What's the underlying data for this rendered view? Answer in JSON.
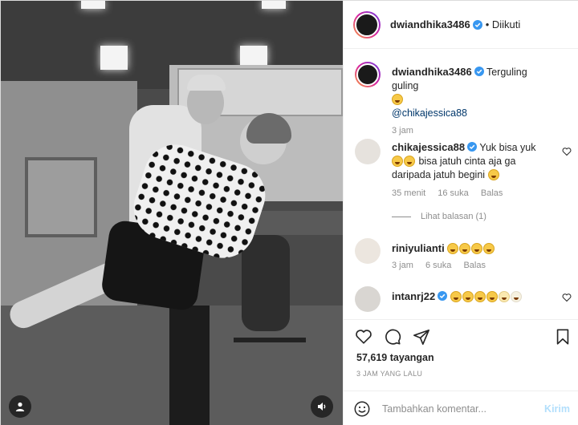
{
  "post": {
    "username": "dwiandhika3486",
    "follow_status": "• Diikuti",
    "caption": {
      "text": "Terguling guling",
      "mention": "@chikajessica88",
      "time": "3 jam"
    }
  },
  "comments": [
    {
      "username": "chikajessica88",
      "text": "Yuk bisa yuk",
      "text2": "bisa jatuh cinta aja ga daripada jatuh begini",
      "time": "35 menit",
      "likes": "16 suka",
      "reply": "Balas",
      "view_replies": "Lihat balasan (1)"
    },
    {
      "username": "riniyulianti",
      "time": "3 jam",
      "likes": "6 suka",
      "reply": "Balas"
    },
    {
      "username": "intanrj22"
    }
  ],
  "stats": {
    "views": "57,619 tayangan",
    "posted": "3 JAM YANG LALU"
  },
  "composer": {
    "placeholder": "Tambahkan komentar...",
    "submit": "Kirim"
  },
  "colors": {
    "verified": "#3897f0",
    "link": "#00376b",
    "muted": "#8e8e8e",
    "submit_disabled": "#b2dffc"
  },
  "icons": [
    "heart-icon",
    "comment-icon",
    "share-icon",
    "bookmark-icon",
    "emoji-icon",
    "sound-icon",
    "user-tag-icon",
    "verified-icon"
  ]
}
